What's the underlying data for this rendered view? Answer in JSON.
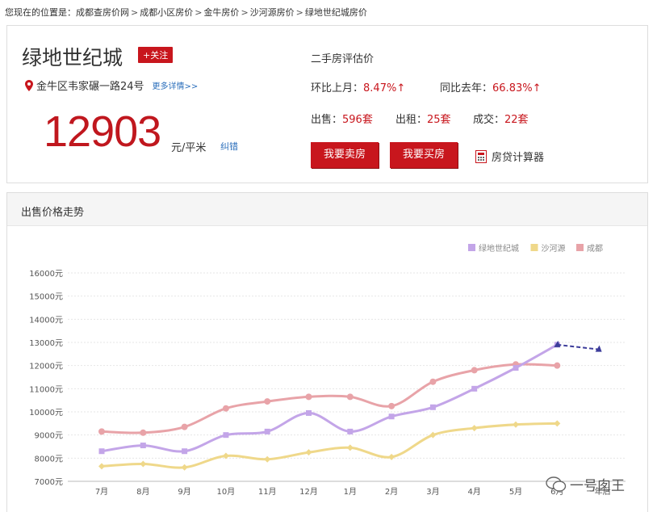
{
  "breadcrumb": {
    "prefix": "您现在的位置是：",
    "items": [
      "成都查房价网",
      "成都小区房价",
      "金牛房价",
      "沙河源房价",
      "绿地世纪城房价"
    ],
    "separator": ">"
  },
  "property": {
    "name": "绿地世纪城",
    "follow_label": "+关注",
    "address": "金牛区韦家碾一路24号",
    "more_label": "更多详情>>",
    "price": "12903",
    "price_unit": "元/平米",
    "correct_label": "纠错"
  },
  "stats": {
    "heading": "二手房评估价",
    "mom_label": "环比上月：",
    "mom_value": "8.47%↑",
    "yoy_label": "同比去年：",
    "yoy_value": "66.83%↑",
    "sale_label": "出售：",
    "sale_value": "596套",
    "rent_label": "出租：",
    "rent_value": "25套",
    "deal_label": "成交：",
    "deal_value": "22套"
  },
  "actions": {
    "sell_label": "我要卖房",
    "buy_label": "我要买房",
    "calc_label": "房贷计算器",
    "calc_icon": "calculator-icon"
  },
  "colors": {
    "accent": "#c8161d",
    "price": "#c0171e",
    "link": "#2a6ebb"
  },
  "chart_section_title": "出售价格走势",
  "chart_data": {
    "type": "line",
    "categories": [
      "7月",
      "8月",
      "9月",
      "10月",
      "11月",
      "12月",
      "1月",
      "2月",
      "3月",
      "4月",
      "5月",
      "6月",
      "一年后"
    ],
    "ylim": [
      7000,
      16000
    ],
    "yticks": [
      "7000元",
      "8000元",
      "9000元",
      "10000元",
      "11000元",
      "12000元",
      "13000元",
      "14000元",
      "15000元",
      "16000元"
    ],
    "grid": true,
    "legend_position": "top-right",
    "series": [
      {
        "name": "绿地世纪城",
        "color": "#c3a5e8",
        "values": [
          8300,
          8550,
          8300,
          9000,
          9150,
          9950,
          9150,
          9800,
          10200,
          11000,
          11900,
          12900
        ],
        "forecast": [
          12900,
          12700
        ]
      },
      {
        "name": "沙河源",
        "color": "#efd88a",
        "values": [
          7650,
          7750,
          7600,
          8100,
          7950,
          8250,
          8450,
          8050,
          9000,
          9300,
          9450,
          9500
        ]
      },
      {
        "name": "成都",
        "color": "#e8a3a8",
        "values": [
          9150,
          9100,
          9350,
          10150,
          10450,
          10650,
          10650,
          10250,
          11300,
          11800,
          12050,
          12000
        ]
      }
    ]
  },
  "watermark": "一号囱王"
}
